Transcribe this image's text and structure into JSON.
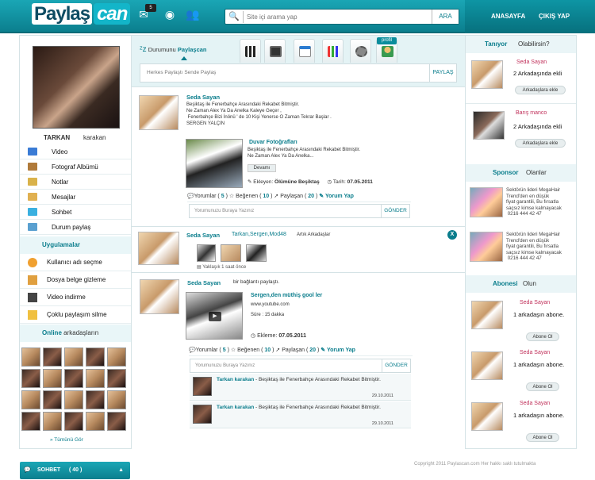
{
  "header": {
    "logo_part1": "Paylaş",
    "logo_part2": "can",
    "message_count": "5",
    "search_placeholder": "Site içi arama yap",
    "search_button": "ARA",
    "nav_home": "ANASAYFA",
    "nav_logout": "ÇIKIŞ YAP"
  },
  "profile": {
    "first_name": "TARKAN",
    "last_name": "karakan"
  },
  "menu": [
    {
      "label": "Video",
      "color": "#3a7bd5"
    },
    {
      "label": "Fotograf Albümü",
      "color": "#b07a3a"
    },
    {
      "label": "Notlar",
      "color": "#d9b24a"
    },
    {
      "label": "Mesajlar",
      "color": "#e0b050"
    },
    {
      "label": "Sohbet",
      "color": "#3ab0e0"
    },
    {
      "label": "Durum paylaş",
      "color": "#5aa0d0"
    }
  ],
  "apps": {
    "title": "Uygulamalar",
    "items": [
      {
        "label": "Kullanıcı adı seçme",
        "color": "#f0a030"
      },
      {
        "label": "Dosya belge gizleme",
        "color": "#e0a040"
      },
      {
        "label": "Video indirme",
        "color": "#444"
      },
      {
        "label": "Çoklu paylaşım silme",
        "color": "#f0c040"
      }
    ]
  },
  "online": {
    "title": "Online",
    "subtitle": "arkadaşların",
    "see_all": "» Tümünü Gör"
  },
  "status": {
    "tab_label_1": "Durumunu",
    "tab_label_2": "Paylaşcan",
    "profile_tab": "profil",
    "input_placeholder": "Herkes Paylaştı  Sende Paylaş",
    "share_button": "PAYLAŞ"
  },
  "post1": {
    "author": "Seda Sayan",
    "text": "Beşiktaş ile Fenerbahçe Arasındaki Rekabet Bitmiştir.\nNe Zaman Alex Ya Da Anelka Kaleye Geçer ,\n Fenerbahçe Bizi İnönü ' de 10 Kişi Yenerse O Zaman Tekrar Başlar .\nSERGEN YALÇIN",
    "wall_title": "Duvar Fotoğrafları",
    "wall_text": "Beşiktaş ile Fenerbahçe Arasındaki Rekabet Bitmiştir.\nNe Zaman Alex Ya Da Anelka...",
    "more": "Devamı",
    "added_by_label": "Ekleyen:",
    "added_by": "Ölümüne Beşiktaş",
    "date_label": "Tarih:",
    "date": "07.05.2011",
    "comments_label": "Yorumlar",
    "comments": "5",
    "likes_label": "Beğenen",
    "likes": "10",
    "shares_label": "Paylaşan",
    "shares": "20",
    "comment_action": "Yorum Yap",
    "comment_placeholder": "Yorumunuzu  Buraya  Yazınız",
    "send": "GÖNDER"
  },
  "post2": {
    "author": "Seda Sayan",
    "tagged": "Tarkan,Sergen,Mod48",
    "tagged_suffix": "Artık Arkadaşlar",
    "time": "Yaklaşık 1 saat  önce",
    "close": "X"
  },
  "post3": {
    "author": "Seda Sayan",
    "action": "bir bağlantı paylaştı.",
    "link_title": "Sergen,den  müthiş  gool ler",
    "link_url": "www.youtube.com",
    "duration": "Süre : 15 dakka",
    "date_label": "Ekleme:",
    "date": "07.05.2011",
    "comments_label": "Yorumlar",
    "comments": "5",
    "likes_label": "Beğenen",
    "likes": "10",
    "shares_label": "Paylaşan",
    "shares": "20",
    "comment_action": "Yorum Yap",
    "comment_placeholder": "Yorumunuzu  Buraya  Yazınız",
    "send": "GÖNDER",
    "comments_list": [
      {
        "name": "Tarkan  karakan",
        "text": "- Beşiktaş ile Fenerbahçe Arasındaki Rekabet Bitmiştir.",
        "date": "29.10.2011"
      },
      {
        "name": "Tarkan  karakan",
        "text": "- Beşiktaş ile Fenerbahçe Arasındaki Rekabet Bitmiştir.",
        "date": "29.10.2011"
      }
    ]
  },
  "right": {
    "know_title": "Tanıyor",
    "know_sub": "Olabilirsin?",
    "people": [
      {
        "name": "Seda Sayan",
        "mutual": "2 Arkadaşında ekli",
        "button": "Arkadaşlara ekle"
      },
      {
        "name": "Barış manco",
        "mutual": "2 Arkadaşında ekli",
        "button": "Arkadaşlara ekle"
      }
    ],
    "sponsor_title": "Sponsor",
    "sponsor_sub": "Olanlar",
    "sponsors": [
      {
        "text": "Sektörün lideri MegaHair\nTrend'den en düşük\nfiyat garantili, Bu fırsatla\nsaçsız kimse kalmayacak\n 0216 444 42 47"
      },
      {
        "text": "Sektörün lideri MegaHair\nTrend'den en düşük\nfiyat garantili, Bu fırsatla\nsaçsız kimse kalmayacak\n 0216 444 42 47"
      }
    ],
    "subscribe_title": "Abonesi",
    "subscribe_sub": "Olun",
    "subscribers": [
      {
        "name": "Seda Sayan",
        "count": "1 arkadaşın abone.",
        "button": "Abone Ol"
      },
      {
        "name": "Seda Sayan",
        "count": "1 arkadaşın abone.",
        "button": "Abone Ol"
      },
      {
        "name": "Seda Sayan",
        "count": "1 arkadaşın abone.",
        "button": "Abone Ol"
      }
    ]
  },
  "chat": {
    "label": "SOHBET",
    "count": "( 40 )"
  },
  "copyright": "Copyright 2011 Paylascan.com Her hakkı saklı tutulmakta"
}
